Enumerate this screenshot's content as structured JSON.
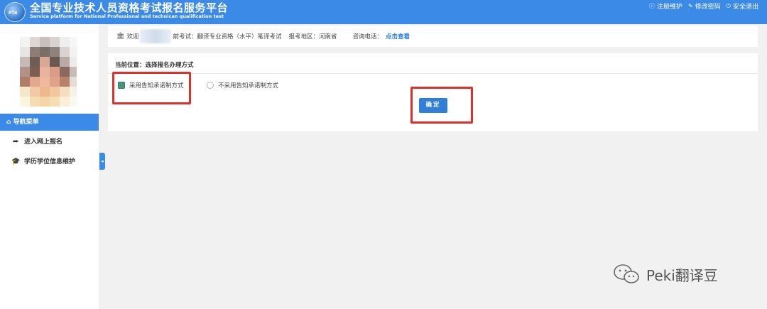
{
  "header": {
    "title": "全国专业技术人员资格考试报名服务平台",
    "subtitle": "Service platform for National Professional and technican qualification test",
    "logo_text": "PTA",
    "links": [
      {
        "label": "注册维护",
        "icon": "info-icon"
      },
      {
        "label": "修改密码",
        "icon": "edit-icon"
      },
      {
        "label": "安全退出",
        "icon": "power-icon"
      }
    ]
  },
  "sidebar": {
    "nav_header": "导航菜单",
    "items": [
      {
        "label": "进入网上报名",
        "icon": "share-arrow-icon"
      },
      {
        "label": "学历学位信息维护",
        "icon": "graduation-cap-icon"
      }
    ]
  },
  "infobar": {
    "welcome": "欢迎",
    "exam_prefix": "前考试：",
    "exam_value": "翻译专业资格（水平）笔译考试",
    "region_label": "报考地区：",
    "region_value": "河南省",
    "phone_label": "咨询电话：",
    "phone_link": "点击查看"
  },
  "panel": {
    "breadcrumb": "当前位置：选择报名办理方式",
    "options": [
      {
        "label": "采用告知承诺制方式",
        "selected": true
      },
      {
        "label": "不采用告知承诺制方式",
        "selected": false
      }
    ],
    "confirm_label": "确定"
  },
  "watermark": {
    "text": "Peki翻译豆"
  },
  "colors": {
    "primary": "#3b8ae8",
    "button": "#2f7fd6",
    "highlight": "#e0302a",
    "link": "#2a7de1"
  }
}
